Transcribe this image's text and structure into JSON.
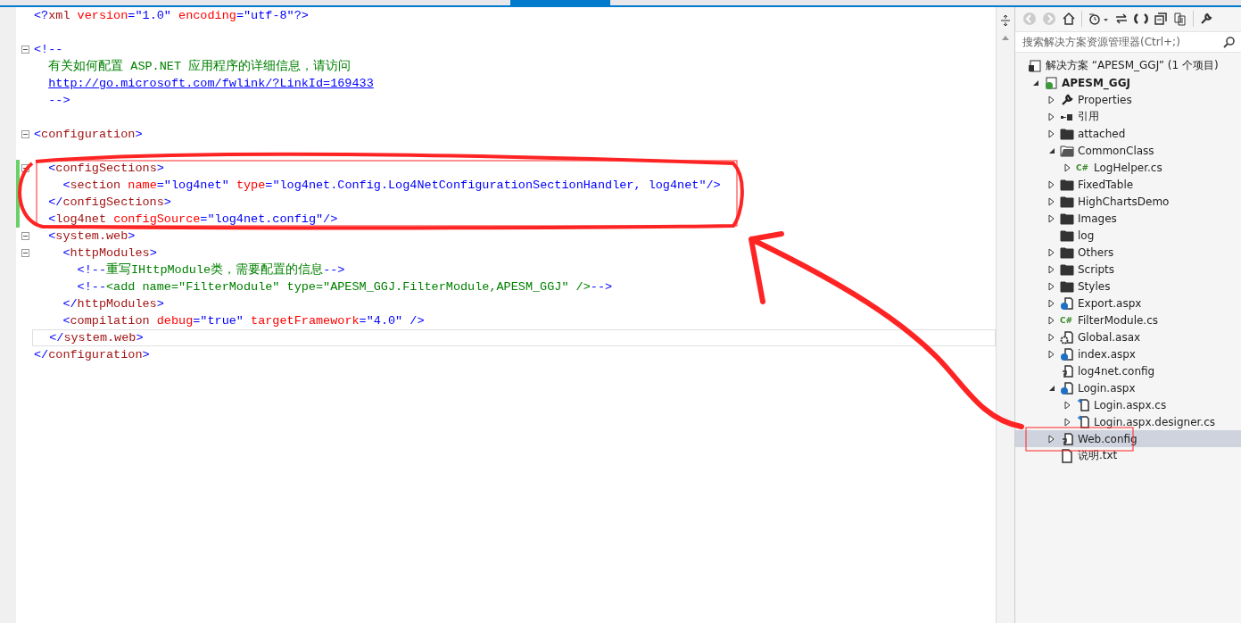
{
  "editor": {
    "lines": [
      {
        "fold": false,
        "modified": false,
        "current": false,
        "tokens": [
          {
            "kind": "delim",
            "text": "<?"
          },
          {
            "kind": "name",
            "text": "xml"
          },
          {
            "kind": "attr",
            "text": " version"
          },
          {
            "kind": "delim",
            "text": "=\""
          },
          {
            "kind": "value",
            "text": "1.0"
          },
          {
            "kind": "delim",
            "text": "\""
          },
          {
            "kind": "attr",
            "text": " encoding"
          },
          {
            "kind": "delim",
            "text": "=\""
          },
          {
            "kind": "value",
            "text": "utf-8"
          },
          {
            "kind": "delim",
            "text": "\"?>"
          }
        ]
      },
      {
        "kind": "blank"
      },
      {
        "fold": true,
        "modified": false,
        "current": false,
        "tokens": [
          {
            "kind": "delim",
            "text": "<!--"
          }
        ]
      },
      {
        "fold": false,
        "modified": false,
        "current": false,
        "tokens": [
          {
            "kind": "comment",
            "text": "  有关如何配置 ASP.NET 应用程序的详细信息，请访问"
          }
        ]
      },
      {
        "fold": false,
        "modified": false,
        "current": false,
        "tokens": [
          {
            "kind": "link",
            "text": "  http://go.microsoft.com/fwlink/?LinkId=169433"
          }
        ]
      },
      {
        "fold": false,
        "modified": false,
        "current": false,
        "tokens": [
          {
            "kind": "delim",
            "text": "  -->"
          }
        ]
      },
      {
        "kind": "blank"
      },
      {
        "fold": true,
        "modified": false,
        "current": false,
        "tokens": [
          {
            "kind": "delim",
            "text": "<"
          },
          {
            "kind": "name",
            "text": "configuration"
          },
          {
            "kind": "delim",
            "text": ">"
          }
        ]
      },
      {
        "kind": "blank"
      },
      {
        "fold": true,
        "modified": true,
        "current": false,
        "tokens": [
          {
            "kind": "delim",
            "text": "  <"
          },
          {
            "kind": "name",
            "text": "configSections"
          },
          {
            "kind": "delim",
            "text": ">"
          }
        ]
      },
      {
        "fold": false,
        "modified": true,
        "current": false,
        "tokens": [
          {
            "kind": "delim",
            "text": "    <"
          },
          {
            "kind": "name",
            "text": "section"
          },
          {
            "kind": "attr",
            "text": " name"
          },
          {
            "kind": "delim",
            "text": "=\""
          },
          {
            "kind": "value",
            "text": "log4net"
          },
          {
            "kind": "delim",
            "text": "\""
          },
          {
            "kind": "attr",
            "text": " type"
          },
          {
            "kind": "delim",
            "text": "=\""
          },
          {
            "kind": "value",
            "text": "log4net.Config.Log4NetConfigurationSectionHandler, log4net"
          },
          {
            "kind": "delim",
            "text": "\"/>"
          }
        ]
      },
      {
        "fold": false,
        "modified": true,
        "current": false,
        "tokens": [
          {
            "kind": "delim",
            "text": "  </"
          },
          {
            "kind": "name",
            "text": "configSections"
          },
          {
            "kind": "delim",
            "text": ">"
          }
        ]
      },
      {
        "fold": false,
        "modified": true,
        "current": false,
        "tokens": [
          {
            "kind": "delim",
            "text": "  <"
          },
          {
            "kind": "name",
            "text": "log4net"
          },
          {
            "kind": "attr",
            "text": " configSource"
          },
          {
            "kind": "delim",
            "text": "=\""
          },
          {
            "kind": "value",
            "text": "log4net.config"
          },
          {
            "kind": "delim",
            "text": "\"/>"
          }
        ]
      },
      {
        "fold": true,
        "modified": false,
        "current": false,
        "tokens": [
          {
            "kind": "delim",
            "text": "  <"
          },
          {
            "kind": "name",
            "text": "system.web"
          },
          {
            "kind": "delim",
            "text": ">"
          }
        ]
      },
      {
        "fold": true,
        "modified": false,
        "current": false,
        "tokens": [
          {
            "kind": "delim",
            "text": "    <"
          },
          {
            "kind": "name",
            "text": "httpModules"
          },
          {
            "kind": "delim",
            "text": ">"
          }
        ]
      },
      {
        "fold": false,
        "modified": false,
        "current": false,
        "tokens": [
          {
            "kind": "delim",
            "text": "      <!--"
          },
          {
            "kind": "comment",
            "text": "重写IHttpModule类，需要配置的信息"
          },
          {
            "kind": "delim",
            "text": "-->"
          }
        ]
      },
      {
        "fold": false,
        "modified": false,
        "current": false,
        "tokens": [
          {
            "kind": "delim",
            "text": "      <!--"
          },
          {
            "kind": "comment",
            "text": "<add name=\"FilterModule\" type=\"APESM_GGJ.FilterModule,APESM_GGJ\" />"
          },
          {
            "kind": "delim",
            "text": "-->"
          }
        ]
      },
      {
        "fold": false,
        "modified": false,
        "current": false,
        "tokens": [
          {
            "kind": "delim",
            "text": "    </"
          },
          {
            "kind": "name",
            "text": "httpModules"
          },
          {
            "kind": "delim",
            "text": ">"
          }
        ]
      },
      {
        "fold": false,
        "modified": false,
        "current": false,
        "tokens": [
          {
            "kind": "delim",
            "text": "    <"
          },
          {
            "kind": "name",
            "text": "compilation"
          },
          {
            "kind": "attr",
            "text": " debug"
          },
          {
            "kind": "delim",
            "text": "=\""
          },
          {
            "kind": "value",
            "text": "true"
          },
          {
            "kind": "delim",
            "text": "\""
          },
          {
            "kind": "attr",
            "text": " targetFramework"
          },
          {
            "kind": "delim",
            "text": "=\""
          },
          {
            "kind": "value",
            "text": "4.0"
          },
          {
            "kind": "delim",
            "text": "\" />"
          }
        ]
      },
      {
        "fold": false,
        "modified": false,
        "current": true,
        "tokens": [
          {
            "kind": "delim",
            "text": "  </"
          },
          {
            "kind": "name",
            "text": "system.web"
          },
          {
            "kind": "delim",
            "text": ">"
          }
        ]
      },
      {
        "fold": false,
        "modified": false,
        "current": false,
        "tokens": [
          {
            "kind": "delim",
            "text": "</"
          },
          {
            "kind": "name",
            "text": "configuration"
          },
          {
            "kind": "delim",
            "text": ">"
          }
        ]
      }
    ]
  },
  "solution_explorer": {
    "search": {
      "placeholder": "搜索解决方案资源管理器(Ctrl+;)"
    },
    "tree": [
      {
        "label": "解决方案 “APESM_GGJ” (1 个项目)",
        "kind": "solution",
        "expandable": false,
        "selected": false,
        "children": [
          {
            "label": "APESM_GGJ",
            "kind": "project",
            "expandable": true,
            "expanded": true,
            "selected": false,
            "children": [
              {
                "label": "Properties",
                "kind": "wrench",
                "expandable": true,
                "expanded": false,
                "selected": false
              },
              {
                "label": "引用",
                "kind": "reference",
                "expandable": true,
                "expanded": false,
                "selected": false
              },
              {
                "label": "attached",
                "kind": "folder",
                "expandable": true,
                "expanded": false,
                "selected": false
              },
              {
                "label": "CommonClass",
                "kind": "folder-open",
                "expandable": true,
                "expanded": true,
                "selected": false,
                "children": [
                  {
                    "label": "LogHelper.cs",
                    "kind": "csharp",
                    "icon_text": "C#",
                    "expandable": true,
                    "expanded": false,
                    "selected": false
                  }
                ]
              },
              {
                "label": "FixedTable",
                "kind": "folder",
                "expandable": true,
                "expanded": false,
                "selected": false
              },
              {
                "label": "HighChartsDemo",
                "kind": "folder",
                "expandable": true,
                "expanded": false,
                "selected": false
              },
              {
                "label": "Images",
                "kind": "folder",
                "expandable": true,
                "expanded": false,
                "selected": false
              },
              {
                "label": "log",
                "kind": "folder",
                "expandable": false,
                "selected": false
              },
              {
                "label": "Others",
                "kind": "folder",
                "expandable": true,
                "expanded": false,
                "selected": false
              },
              {
                "label": "Scripts",
                "kind": "folder",
                "expandable": true,
                "expanded": false,
                "selected": false
              },
              {
                "label": "Styles",
                "kind": "folder",
                "expandable": true,
                "expanded": false,
                "selected": false
              },
              {
                "label": "Export.aspx",
                "kind": "web",
                "expandable": true,
                "expanded": false,
                "selected": false
              },
              {
                "label": "FilterModule.cs",
                "kind": "csharp",
                "icon_text": "C#",
                "expandable": true,
                "expanded": false,
                "selected": false
              },
              {
                "label": "Global.asax",
                "kind": "gear",
                "expandable": true,
                "expanded": false,
                "selected": false
              },
              {
                "label": "index.aspx",
                "kind": "web",
                "expandable": true,
                "expanded": false,
                "selected": false
              },
              {
                "label": "log4net.config",
                "kind": "config",
                "expandable": false,
                "selected": false
              },
              {
                "label": "Login.aspx",
                "kind": "web",
                "expandable": true,
                "expanded": true,
                "selected": false,
                "children": [
                  {
                    "label": "Login.aspx.cs",
                    "kind": "code",
                    "expandable": true,
                    "expanded": false,
                    "selected": false
                  },
                  {
                    "label": "Login.aspx.designer.cs",
                    "kind": "code",
                    "expandable": true,
                    "expanded": false,
                    "selected": false
                  }
                ]
              },
              {
                "label": "Web.config",
                "kind": "config",
                "expandable": true,
                "expanded": false,
                "selected": true
              },
              {
                "label": "说明.txt",
                "kind": "text",
                "expandable": false,
                "selected": false
              }
            ]
          }
        ]
      }
    ]
  }
}
